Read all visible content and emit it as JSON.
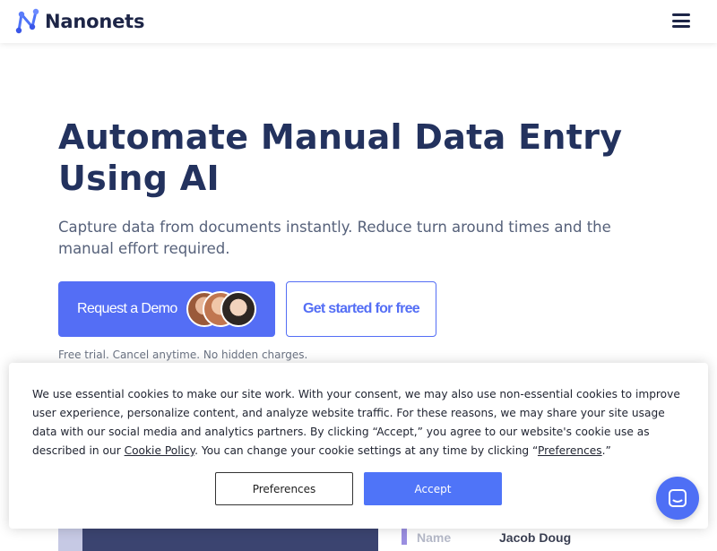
{
  "header": {
    "brand": "Nanonets",
    "menu_icon": "hamburger-menu-icon"
  },
  "hero": {
    "title": "Automate Manual Data Entry Using AI",
    "subtitle": "Capture data from documents instantly. Reduce turn around times and the manual effort required.",
    "demo_button": "Request a Demo",
    "free_button": "Get started for free",
    "note": "Free trial. Cancel anytime. No hidden charges."
  },
  "preview": {
    "name_label": "Name",
    "name_value": "Jacob Doug"
  },
  "cookie": {
    "text_1": "We use essential cookies to make our site work. With your consent, we may also use non-essential cookies to improve user experience, personalize content, and analyze website traffic. For these reasons, we may share your site usage data with our social media and analytics partners. By clicking “Accept,” you agree to our website's cookie use as described in our ",
    "cookie_policy_link": "Cookie Policy",
    "text_2": ". You can change your cookie settings at any time by clicking “",
    "preferences_link": "Preferences",
    "text_3": ".”",
    "preferences_button": "Preferences",
    "accept_button": "Accept"
  },
  "colors": {
    "brand_blue": "#546ef5",
    "title_navy": "#23325e",
    "accept_blue": "#4f74f8",
    "chat_blue": "#4e6ff5"
  },
  "chat": {
    "icon": "chat-launcher-icon"
  }
}
